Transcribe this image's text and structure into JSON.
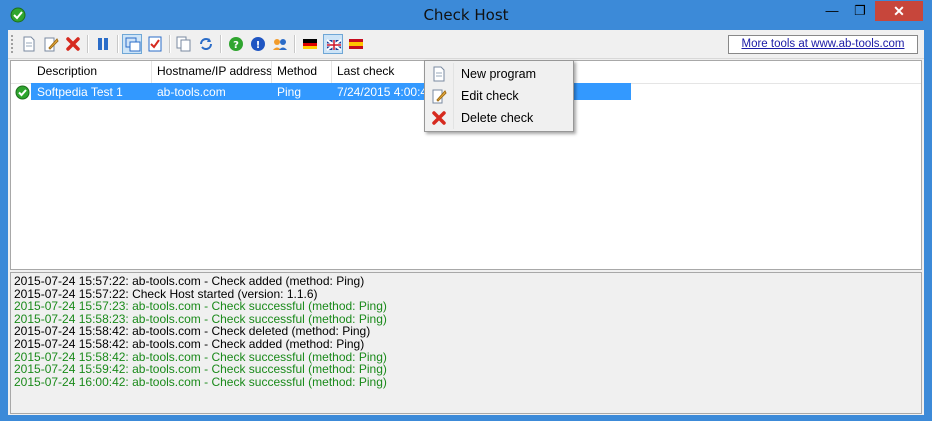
{
  "window": {
    "title": "Check Host",
    "minimize": "—",
    "maximize": "❐",
    "close": "✕",
    "accent": "#3c8ad8"
  },
  "toolbar": {
    "buttons": [
      "new-icon",
      "edit-icon",
      "delete-icon",
      "pause-icon",
      "view-icon",
      "check-icon",
      "copy-icon",
      "refresh-icon",
      "help-icon",
      "info-icon",
      "people-icon",
      "flag-de-icon",
      "flag-uk-icon",
      "flag-es-icon"
    ],
    "more_tools": "More tools at www.ab-tools.com"
  },
  "list": {
    "columns": [
      "Description",
      "Hostname/IP address",
      "Method",
      "Last check"
    ],
    "rows": [
      {
        "description": "Softpedia Test 1",
        "host": "ab-tools.com",
        "method": "Ping",
        "last_check": "7/24/2015 4:00:42"
      }
    ],
    "selected_color": "#3399ff"
  },
  "context_menu": {
    "items": [
      {
        "label": "New program",
        "icon": "new-program-icon"
      },
      {
        "label": "Edit check",
        "icon": "edit-icon"
      },
      {
        "label": "Delete check",
        "icon": "delete-icon"
      }
    ]
  },
  "log": {
    "lines": [
      {
        "text": "2015-07-24 15:57:22: ab-tools.com - Check added (method: Ping)",
        "color": "#000000"
      },
      {
        "text": "2015-07-24 15:57:22: Check Host started (version: 1.1.6)",
        "color": "#000000"
      },
      {
        "text": "2015-07-24 15:57:23: ab-tools.com - Check successful (method: Ping)",
        "color": "#1a8a1a"
      },
      {
        "text": "2015-07-24 15:58:23: ab-tools.com - Check successful (method: Ping)",
        "color": "#1a8a1a"
      },
      {
        "text": "2015-07-24 15:58:42: ab-tools.com - Check deleted (method: Ping)",
        "color": "#000000"
      },
      {
        "text": "2015-07-24 15:58:42: ab-tools.com - Check added (method: Ping)",
        "color": "#000000"
      },
      {
        "text": "2015-07-24 15:58:42: ab-tools.com - Check successful (method: Ping)",
        "color": "#1a8a1a"
      },
      {
        "text": "2015-07-24 15:59:42: ab-tools.com - Check successful (method: Ping)",
        "color": "#1a8a1a"
      },
      {
        "text": "2015-07-24 16:00:42: ab-tools.com - Check successful (method: Ping)",
        "color": "#1a8a1a"
      }
    ]
  }
}
